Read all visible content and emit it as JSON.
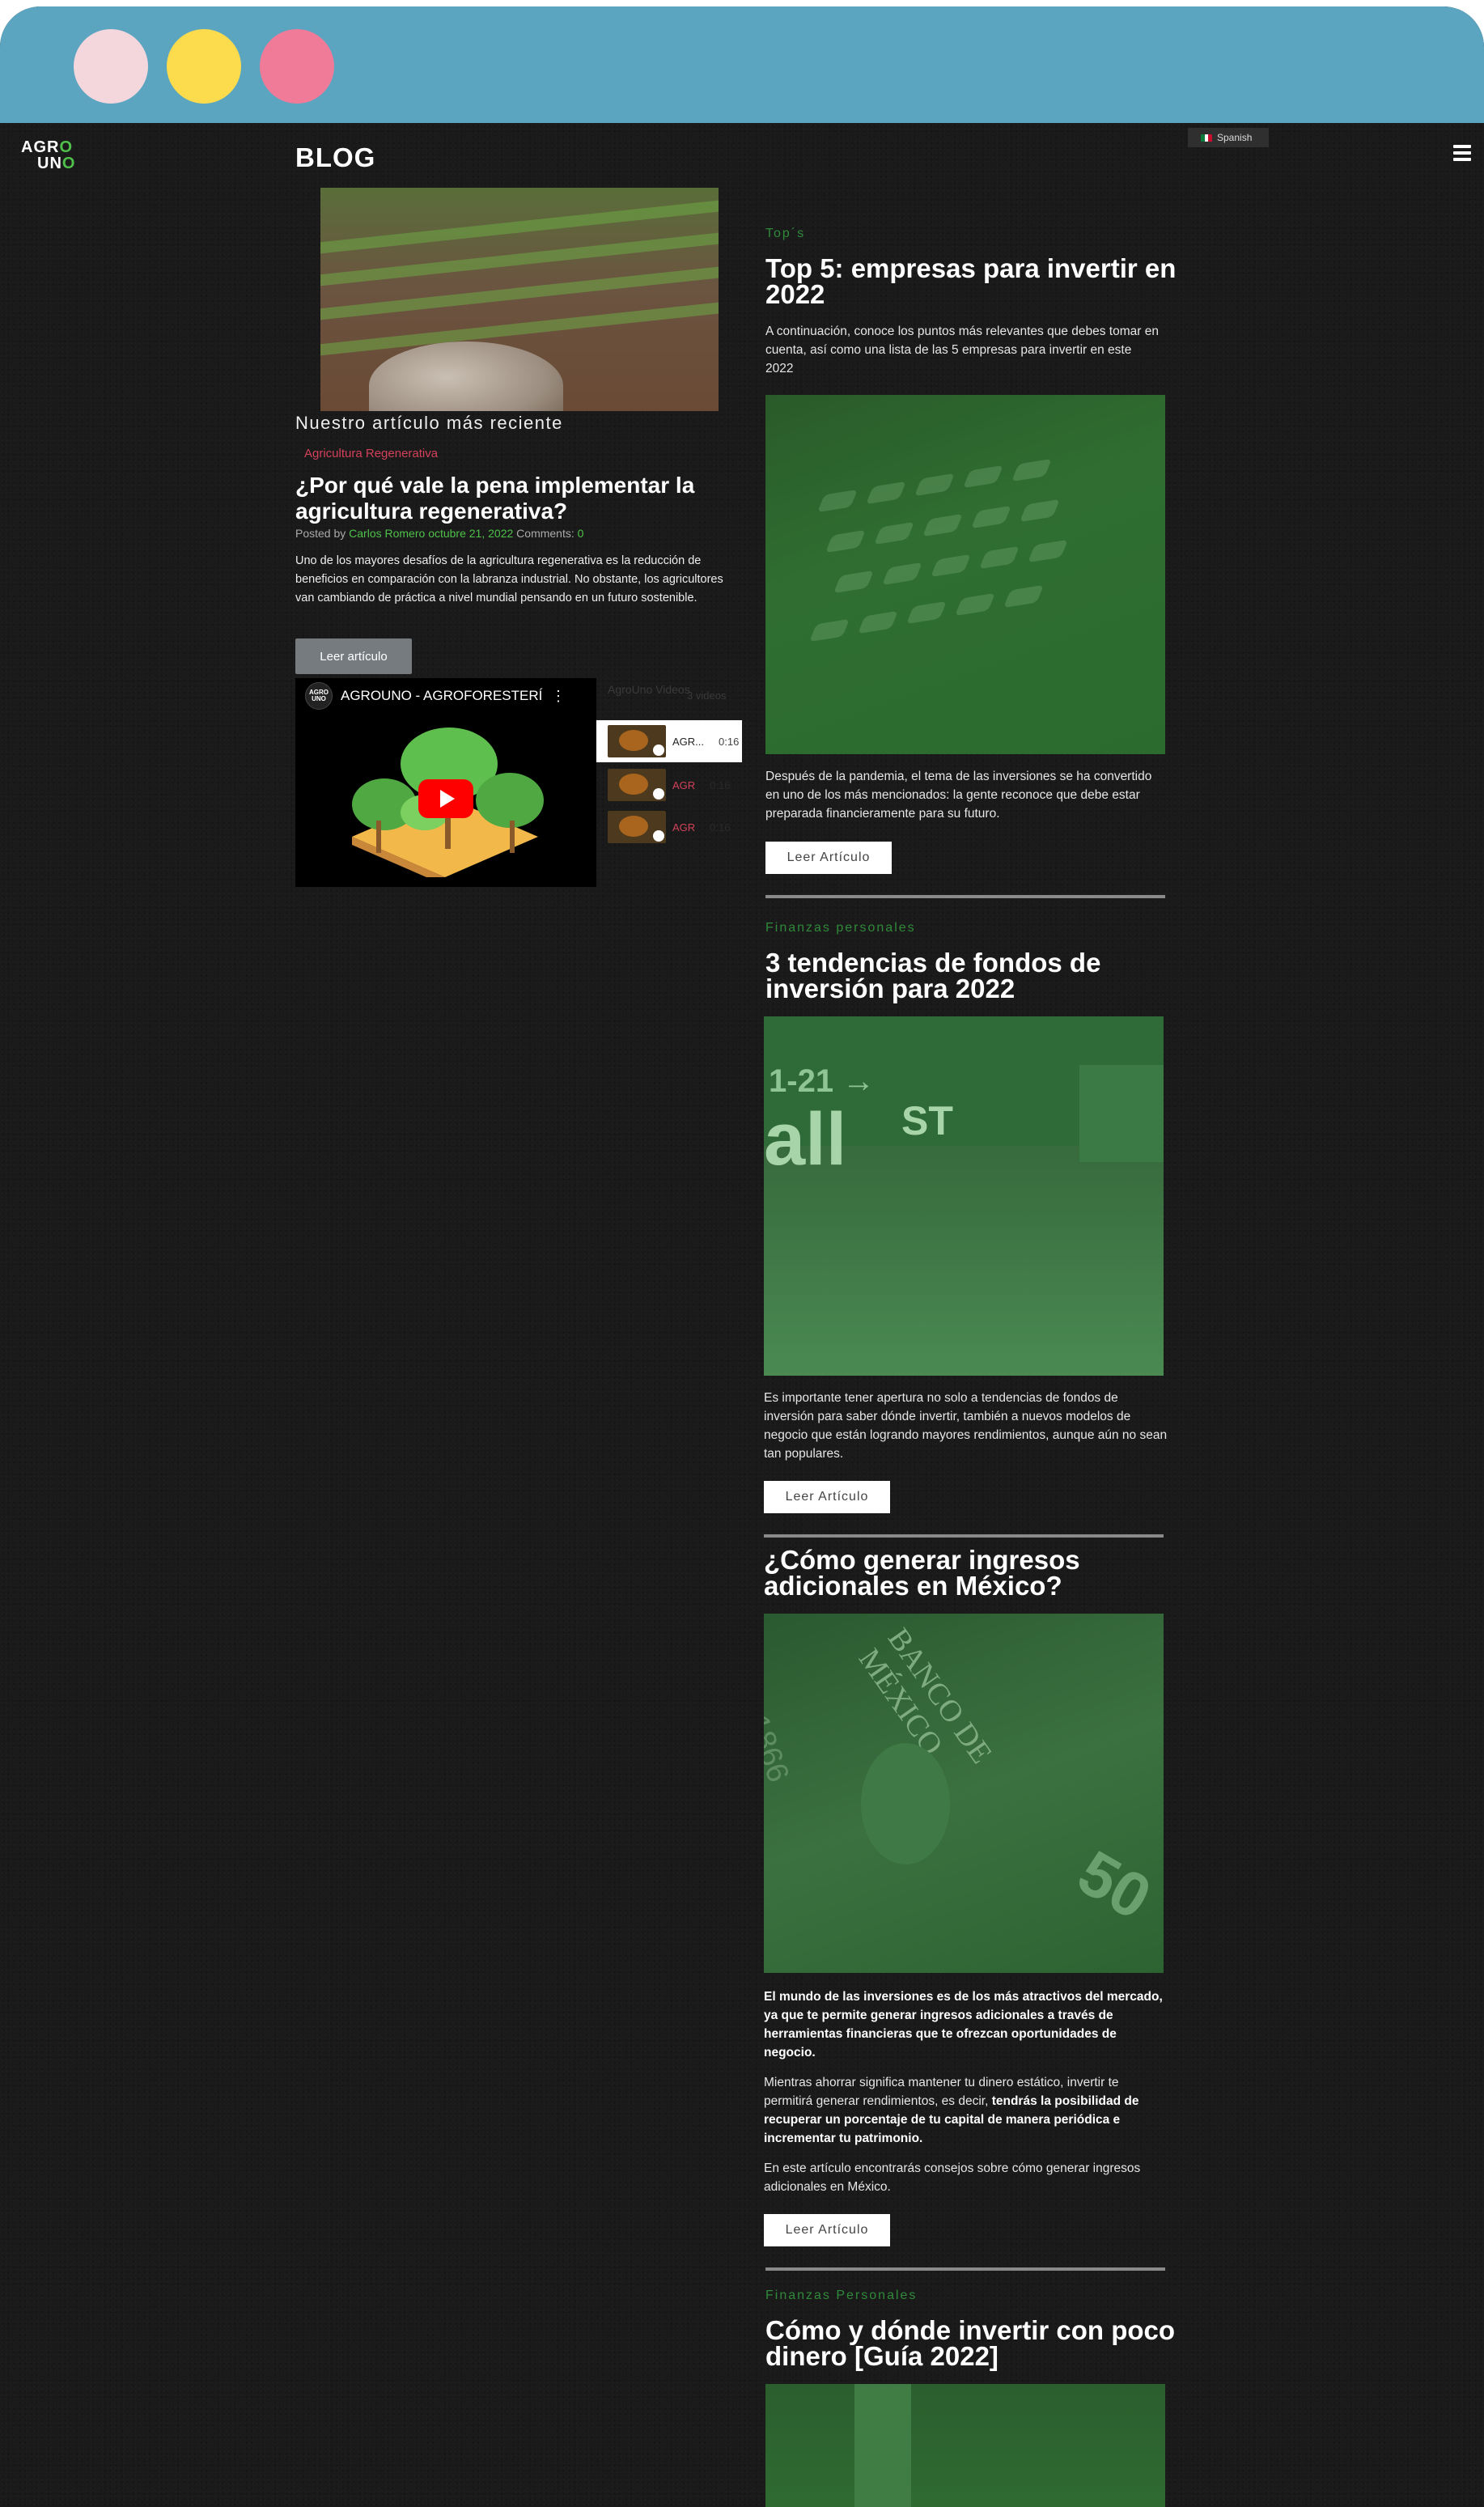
{
  "header": {
    "logo_line1": "AGRO",
    "logo_line2": "UNO",
    "blog_title": "BLOG",
    "language": "Spanish",
    "menu_icon": "hamburger-icon"
  },
  "featured": {
    "recent_label": "Nuestro artículo más reciente",
    "category": "Agricultura Regenerativa",
    "title": "¿Por qué vale la pena implementar la agricultura regenerativa?",
    "posted_by_label": "Posted by",
    "author": "Carlos Romero",
    "date": "octubre 21, 2022",
    "comments_label": "Comments:",
    "comments_count": "0",
    "excerpt": "Uno de los mayores desafíos de la agricultura regenerativa es la reducción de beneficios en comparación con la labranza industrial. No obstante, los agricultores van cambiando de práctica a nivel mundial pensando en un futuro sostenible.",
    "read_button": "Leer artículo"
  },
  "video": {
    "channel_avatar_text": "AGRO UNO",
    "title": "AGROUNO - AGROFORESTERÍ...",
    "playlist_header": "AgroUno Videos",
    "playlist_count": "3 videos",
    "items": [
      {
        "name": "AGR...",
        "duration": "0:16"
      },
      {
        "name": "AGR",
        "duration": "0:16"
      },
      {
        "name": "AGR",
        "duration": "0:16"
      }
    ]
  },
  "articles": [
    {
      "category": "Top´s",
      "title": "Top 5: empresas para invertir en 2022",
      "intro": "A continuación, conoce los puntos más relevantes que debes tomar en cuenta, así como una lista de las 5 empresas para invertir en este 2022",
      "excerpt": "Después de la pandemia, el tema de las inversiones se ha convertido en uno de los más mencionados: la gente reconoce que debe estar preparada financieramente para su futuro.",
      "button": "Leer Artículo"
    },
    {
      "category": "Finanzas personales",
      "title": "3 tendencias de fondos de inversión para 2022",
      "excerpt": "Es importante tener apertura no solo a tendencias de fondos de inversión para saber dónde invertir, también a nuevos modelos de negocio que están logrando mayores rendimientos, aunque aún no sean tan populares.",
      "button": "Leer Artículo"
    },
    {
      "title": "¿Cómo generar ingresos adicionales en México?",
      "p1": "El mundo de las inversiones es de los más atractivos del mercado, ya que te permite generar ingresos adicionales a través de herramientas financieras que te ofrezcan oportunidades de negocio.",
      "p2_a": "Mientras ahorrar significa mantener tu dinero estático, invertir te permitirá generar rendimientos, es decir, ",
      "p2_b": "tendrás la posibilidad de recuperar un porcentaje de tu capital de manera periódica e incrementar tu patrimonio.",
      "p3": "En este artículo encontrarás consejos sobre cómo generar ingresos adicionales en México.",
      "button": "Leer Artículo"
    },
    {
      "category": "Finanzas Personales",
      "title": "Cómo y dónde invertir con poco dinero [Guía 2022]"
    }
  ],
  "colors": {
    "chrome": "#5ba5c0",
    "dot1": "#f4d6dd",
    "dot2": "#fcdb4d",
    "dot3": "#f07b98",
    "accent_green": "#4fc14a",
    "accent_red": "#d2415a"
  }
}
